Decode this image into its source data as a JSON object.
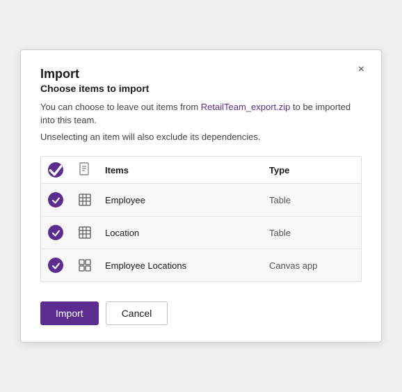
{
  "dialog": {
    "title": "Import",
    "close_label": "×",
    "subtitle_line1": "Choose items to import",
    "subtitle_line2": "You can choose to leave out items from RetailTeam_export.zip to be imported into this team.",
    "subtitle_line3": "Unselecting an item will also exclude its dependencies.",
    "table": {
      "col_items": "Items",
      "col_type": "Type",
      "rows": [
        {
          "name": "Employee",
          "type": "Table",
          "icon": "table"
        },
        {
          "name": "Location",
          "type": "Table",
          "icon": "table"
        },
        {
          "name": "Employee Locations",
          "type": "Canvas app",
          "icon": "canvas"
        }
      ]
    },
    "footer": {
      "import_label": "Import",
      "cancel_label": "Cancel"
    }
  }
}
